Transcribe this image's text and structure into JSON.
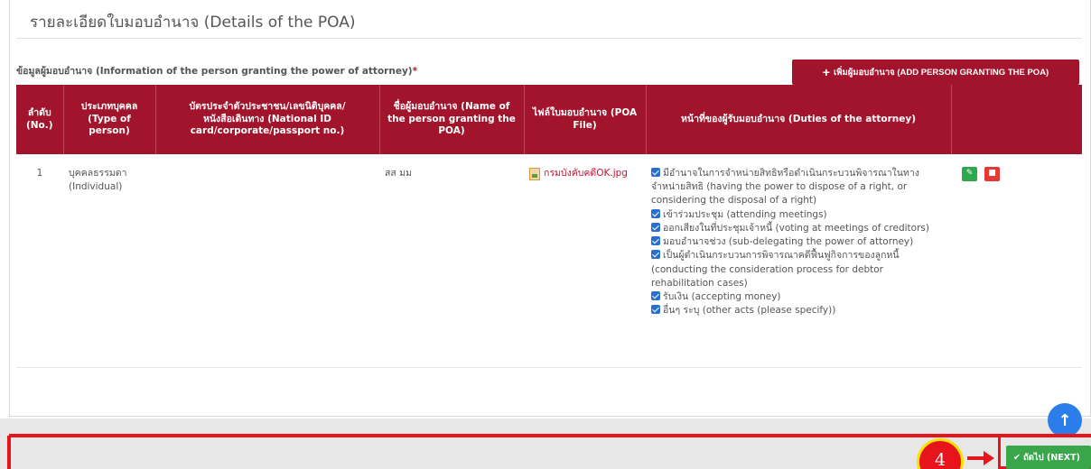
{
  "page": {
    "title": "รายละเอียดใบมอบอำนาจ (Details of the POA)",
    "section_label": "ข้อมูลผู้มอบอำนาจ (Information of the person granting the power of attorney)",
    "required_mark": "*",
    "add_button_label": "เพิ่มผู้มอบอำนาจ (ADD PERSON GRANTING THE POA)"
  },
  "table": {
    "headers": [
      "ลำดับ (No.)",
      "ประเภทบุคคล (Type of person)",
      "บัตรประจำตัวประชาชน/เลขนิติบุคคล/หนังสือเดินทาง (National ID card/corporate/passport no.)",
      "ชื่อผู้มอบอำนาจ (Name of the person granting the POA)",
      "ไฟล์ใบมอบอำนาจ (POA File)",
      "หน้าที่ของผู้รับมอบอำนาจ (Duties of the attorney)",
      ""
    ],
    "rows": [
      {
        "no": "1",
        "type_th": "บุคคลธรรมดา",
        "type_en": "(Individual)",
        "id_no": "",
        "name": "สส มม",
        "file": "กรมบังคับคดีOK.jpg",
        "duties": [
          "มีอำนาจในการจำหน่ายสิทธิหรือดำเนินกระบวนพิจารณาในทางจำหน่ายสิทธิ (having the power to dispose of a right, or considering the disposal of a right)",
          "เข้าร่วมประชุม (attending meetings)",
          "ออกเสียงในที่ประชุมเจ้าหนี้ (voting at meetings of creditors)",
          "มอบอำนาจช่วง (sub-delegating the power of attorney)",
          "เป็นผู้ดำเนินกระบวนการพิจารณาคดีฟื้นฟูกิจการของลูกหนี้ (conducting the consideration process for debtor rehabilitation cases)",
          "รับเงิน (accepting money)",
          "อื่นๆ ระบุ (other acts (please specify))"
        ]
      }
    ]
  },
  "footer": {
    "step_number": "4",
    "next_label": "ถัดไป (NEXT)"
  },
  "icons": {
    "add": "plus-icon",
    "file": "image-file-icon",
    "checkbox": "checkbox-checked-icon",
    "edit": "pencil-icon",
    "delete": "trash-icon",
    "scroll": "arrow-up-icon",
    "next": "check-icon"
  },
  "colors": {
    "header_bg": "#a1142c",
    "next_green": "#3aa64c",
    "annotation_red": "#e8141c",
    "checkbox_blue": "#2a6fcf"
  }
}
